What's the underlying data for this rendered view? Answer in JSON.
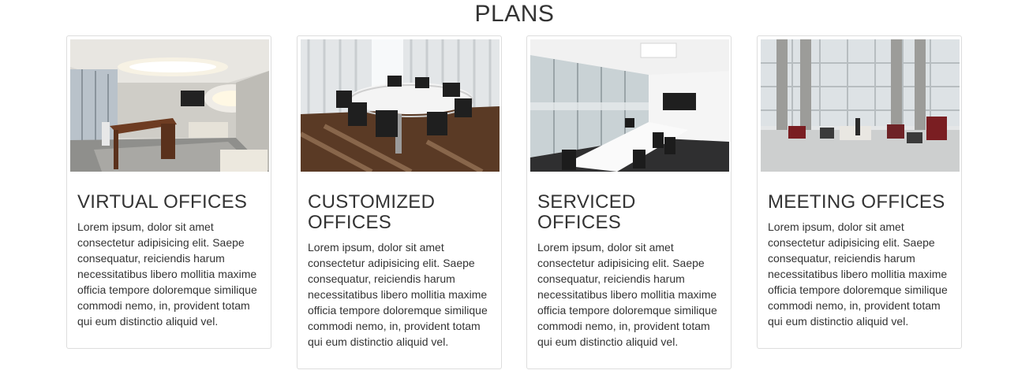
{
  "section": {
    "title": "PLANS"
  },
  "cards": [
    {
      "title": "VIRTUAL OFFICES",
      "text": "Lorem ipsum, dolor sit amet consectetur adipisicing elit. Saepe consequatur, reiciendis harum necessitatibus libero mollitia maxime officia tempore doloremque similique commodi nemo, in, provident totam qui eum distinctio aliquid vel.",
      "image": "private-office-photo"
    },
    {
      "title": "CUSTOMIZED OFFICES",
      "text": "Lorem ipsum, dolor sit amet consectetur adipisicing elit. Saepe consequatur, reiciendis harum necessitatibus libero mollitia maxime officia tempore doloremque similique commodi nemo, in, provident totam qui eum distinctio aliquid vel.",
      "image": "conference-table-photo"
    },
    {
      "title": "SERVICED OFFICES",
      "text": "Lorem ipsum, dolor sit amet consectetur adipisicing elit. Saepe consequatur, reiciendis harum necessitatibus libero mollitia maxime officia tempore doloremque similique commodi nemo, in, provident totam qui eum distinctio aliquid vel.",
      "image": "glass-meeting-room-photo"
    },
    {
      "title": "MEETING OFFICES",
      "text": "Lorem ipsum, dolor sit amet consectetur adipisicing elit. Saepe consequatur, reiciendis harum necessitatibus libero mollitia maxime officia tempore doloremque similique commodi nemo, in, provident totam qui eum distinctio aliquid vel.",
      "image": "lobby-lounge-photo"
    }
  ]
}
